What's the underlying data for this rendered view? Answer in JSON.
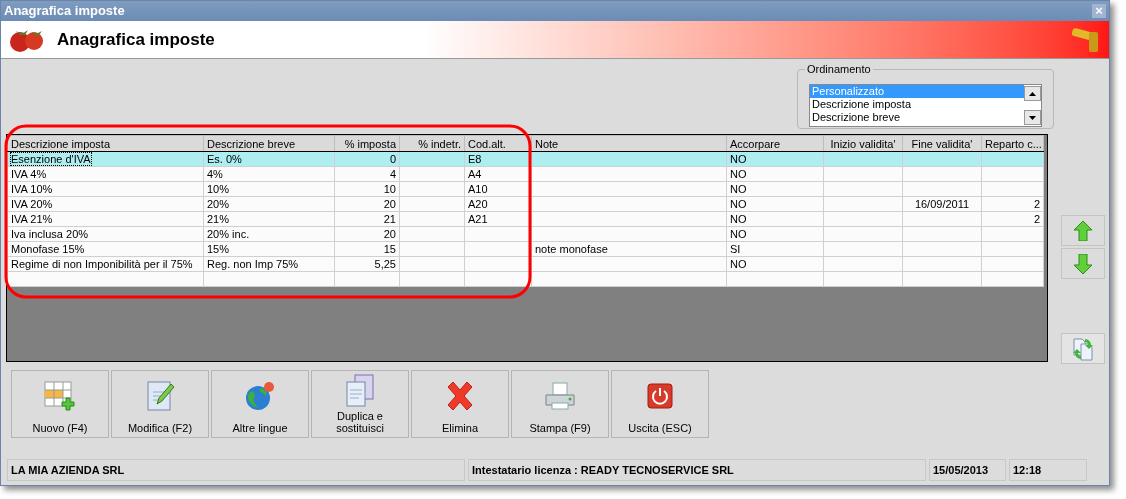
{
  "window": {
    "title": "Anagrafica imposte",
    "heading": "Anagrafica imposte",
    "close": "×"
  },
  "ordinamento": {
    "label": "Ordinamento",
    "options": [
      {
        "label": "Personalizzato",
        "selected": true
      },
      {
        "label": "Descrizione imposta",
        "selected": false
      },
      {
        "label": "Descrizione breve",
        "selected": false
      }
    ]
  },
  "table": {
    "columns": [
      "Descrizione imposta",
      "Descrizione breve",
      "% imposta",
      "% indetr.",
      "Cod.alt.",
      "Note",
      "Accorpare",
      "Inizio validita'",
      "Fine validita'",
      "Reparto c..."
    ],
    "rows": [
      {
        "selected": true,
        "cells": [
          "Esenzione d'IVA",
          "Es. 0%",
          "0",
          "",
          "E8",
          "",
          "NO",
          "",
          "",
          ""
        ]
      },
      {
        "selected": false,
        "cells": [
          "IVA 4%",
          "4%",
          "4",
          "",
          "A4",
          "",
          "NO",
          "",
          "",
          ""
        ]
      },
      {
        "selected": false,
        "cells": [
          "IVA 10%",
          "10%",
          "10",
          "",
          "A10",
          "",
          "NO",
          "",
          "",
          ""
        ]
      },
      {
        "selected": false,
        "cells": [
          "IVA 20%",
          "20%",
          "20",
          "",
          "A20",
          "",
          "NO",
          "",
          "16/09/2011",
          "2"
        ]
      },
      {
        "selected": false,
        "cells": [
          "IVA 21%",
          "21%",
          "21",
          "",
          "A21",
          "",
          "NO",
          "",
          "",
          "2"
        ]
      },
      {
        "selected": false,
        "cells": [
          "Iva inclusa 20%",
          "20% inc.",
          "20",
          "",
          "",
          "",
          "NO",
          "",
          "",
          ""
        ]
      },
      {
        "selected": false,
        "cells": [
          "Monofase 15%",
          "15%",
          "15",
          "",
          "",
          "note monofase",
          "SI",
          "",
          "",
          ""
        ]
      },
      {
        "selected": false,
        "cells": [
          "Regime di non Imponibilità per il 75%",
          "Reg. non Imp 75%",
          "5,25",
          "",
          "",
          "",
          "NO",
          "",
          "",
          ""
        ]
      }
    ]
  },
  "buttons": [
    "Nuovo (F4)",
    "Modifica (F2)",
    "Altre lingue",
    "Duplica e sostituisci",
    "Elimina",
    "Stampa (F9)",
    "Uscita (ESC)"
  ],
  "status_bar": {
    "company": "LA MIA AZIENDA SRL",
    "license": "Intestatario licenza : READY TECNOSERVICE SRL",
    "date": "15/05/2013",
    "time": "12:18"
  }
}
